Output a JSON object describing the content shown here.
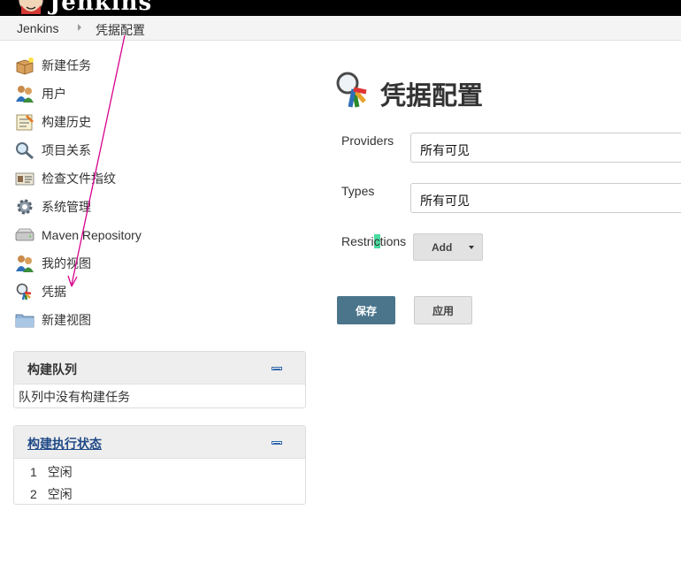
{
  "header": {
    "logo_text": "Jenkins"
  },
  "breadcrumb": {
    "items": [
      "Jenkins",
      "凭据配置"
    ]
  },
  "sidebar": {
    "items": [
      {
        "label": "新建任务",
        "icon": "new-package-icon"
      },
      {
        "label": "用户",
        "icon": "users-icon"
      },
      {
        "label": "构建历史",
        "icon": "notepad-icon"
      },
      {
        "label": "项目关系",
        "icon": "magnifier-icon"
      },
      {
        "label": "检查文件指纹",
        "icon": "fingerprint-icon"
      },
      {
        "label": "系统管理",
        "icon": "gear-icon"
      },
      {
        "label": "Maven Repository",
        "icon": "drive-icon"
      },
      {
        "label": "我的视图",
        "icon": "users-icon"
      },
      {
        "label": "凭据",
        "icon": "credentials-icon"
      },
      {
        "label": "新建视图",
        "icon": "folder-icon"
      }
    ]
  },
  "build_queue": {
    "title": "构建队列",
    "empty_text": "队列中没有构建任务"
  },
  "executor_status": {
    "title": "构建执行状态",
    "executors": [
      {
        "num": "1",
        "state": "空闲"
      },
      {
        "num": "2",
        "state": "空闲"
      }
    ]
  },
  "main": {
    "title": "凭据配置",
    "providers": {
      "label": "Providers",
      "value": "所有可见"
    },
    "types": {
      "label": "Types",
      "value": "所有可见"
    },
    "restrictions": {
      "label_a": "Restri",
      "label_hl": "c",
      "label_b": "tions",
      "add_label": "Add"
    },
    "save_label": "保存",
    "apply_label": "应用"
  },
  "colors": {
    "accent_button": "#4b758b",
    "annotation_arrow": "#d6008c"
  }
}
